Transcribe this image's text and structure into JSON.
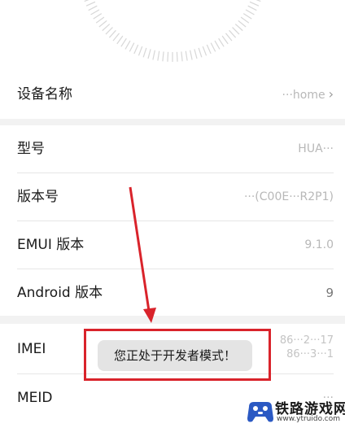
{
  "device_name": {
    "label": "设备名称",
    "value": "···home"
  },
  "rows": [
    {
      "label": "型号",
      "value": "HUA···"
    },
    {
      "label": "版本号",
      "value": "···(C00E···R2P1)"
    },
    {
      "label": "EMUI 版本",
      "value": "9.1.0"
    },
    {
      "label": "Android 版本",
      "value": "9"
    },
    {
      "label": "IMEI",
      "value_1": "86···2···17",
      "value_2": "86···3···1"
    },
    {
      "label": "MEID",
      "value": "···"
    }
  ],
  "toast": {
    "text": "您正处于开发者模式！"
  },
  "watermark": {
    "brand": "铁路游戏网",
    "url": "www.ytruido.com"
  },
  "colors": {
    "annotation_red": "#d9232b",
    "toast_bg": "#e4e4e4",
    "page_bg": "#f2f2f2"
  }
}
